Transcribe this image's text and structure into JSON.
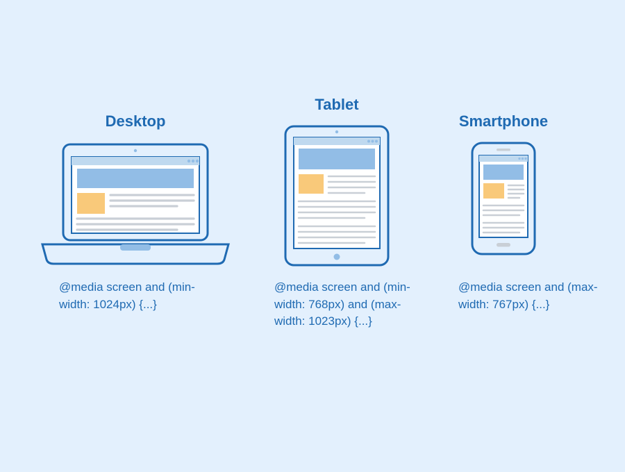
{
  "devices": {
    "desktop": {
      "title": "Desktop",
      "media_query": "@media screen and (min-width: 1024px) {...}"
    },
    "tablet": {
      "title": "Tablet",
      "media_query": "@media screen and (min-width: 768px) and (max-width: 1023px) {...}"
    },
    "smartphone": {
      "title": "Smartphone",
      "media_query": "@media screen and (max-width: 767px) {...}"
    }
  },
  "colors": {
    "background": "#e3f0fd",
    "outline": "#1f6ab2",
    "header_light": "#bfd9ef",
    "header_mid": "#92bde6",
    "accent_orange": "#f9c97a",
    "content_gray": "#c9cfd6"
  }
}
